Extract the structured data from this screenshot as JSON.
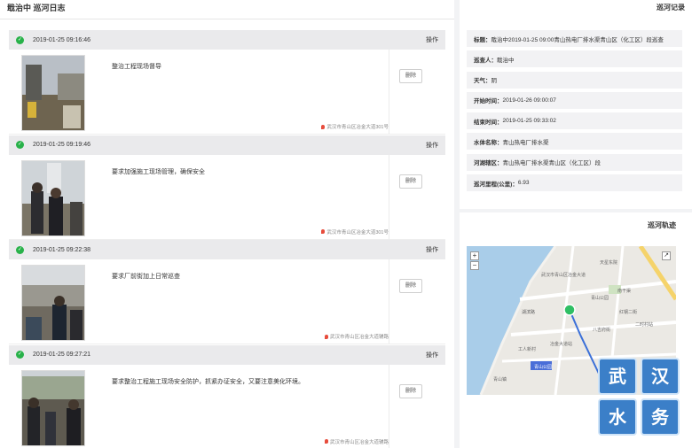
{
  "left": {
    "title": "戢治中 巡河日志"
  },
  "records": [
    {
      "time": "2019-01-25 09:16:46",
      "op_label": "操作",
      "text": "整治工程现场督导",
      "delete_label": "删除",
      "location": "武汉市青山区冶金大道301号"
    },
    {
      "time": "2019-01-25 09:19:46",
      "op_label": "操作",
      "text": "要求加强施工现场管理，确保安全",
      "delete_label": "删除",
      "location": "武汉市青山区冶金大道301号"
    },
    {
      "time": "2019-01-25 09:22:38",
      "op_label": "操作",
      "text": "要求厂前街加上日常巡查",
      "delete_label": "删除",
      "location": "武汉市青山区冶金大道辅路"
    },
    {
      "time": "2019-01-25 09:27:21",
      "op_label": "操作",
      "text": "要求整治工程施工现场安全防护，抓紧办证安全，又要注意美化环境。",
      "delete_label": "删除",
      "location": "武汉市青山区冶金大道辅路"
    }
  ],
  "right": {
    "title": "巡河记录",
    "info": [
      {
        "key": "标题：",
        "value": "戢治中2019-01-25 09:00青山热电厂排水渠青山区（化工区）段巡查"
      },
      {
        "key": "巡查人：",
        "value": "戢治中"
      },
      {
        "key": "天气：",
        "value": "阴"
      },
      {
        "key": "开始时间：",
        "value": "2019-01-26 09:00:07"
      },
      {
        "key": "结束时间：",
        "value": "2019-01-25 09:33:02"
      },
      {
        "key": "水体名称：",
        "value": "青山热电厂排水渠"
      },
      {
        "key": "河湖辖区：",
        "value": "青山热电厂排水渠青山区（化工区）段"
      },
      {
        "key": "巡河里程(公里)：",
        "value": "6.93"
      }
    ],
    "map_title": "巡河轨迹",
    "zoom_in": "+",
    "zoom_out": "−",
    "fullscreen_icon": "↗",
    "map_labels": [
      "天星东院",
      "武汉市青山区冶金大道",
      "南干渠",
      "青山公园",
      "湖滨路",
      "红钢二街",
      "二时村站",
      "八吉府街",
      "工人新村",
      "冶金大道站",
      "青山镇"
    ],
    "map_station_label": "青山公园"
  },
  "watermark": [
    "武",
    "汉",
    "水",
    "务"
  ],
  "colors": {
    "check": "#29b24a",
    "water": "#a9cde9",
    "track": "#3a6fd8",
    "watermark": "#3b7fc8"
  }
}
